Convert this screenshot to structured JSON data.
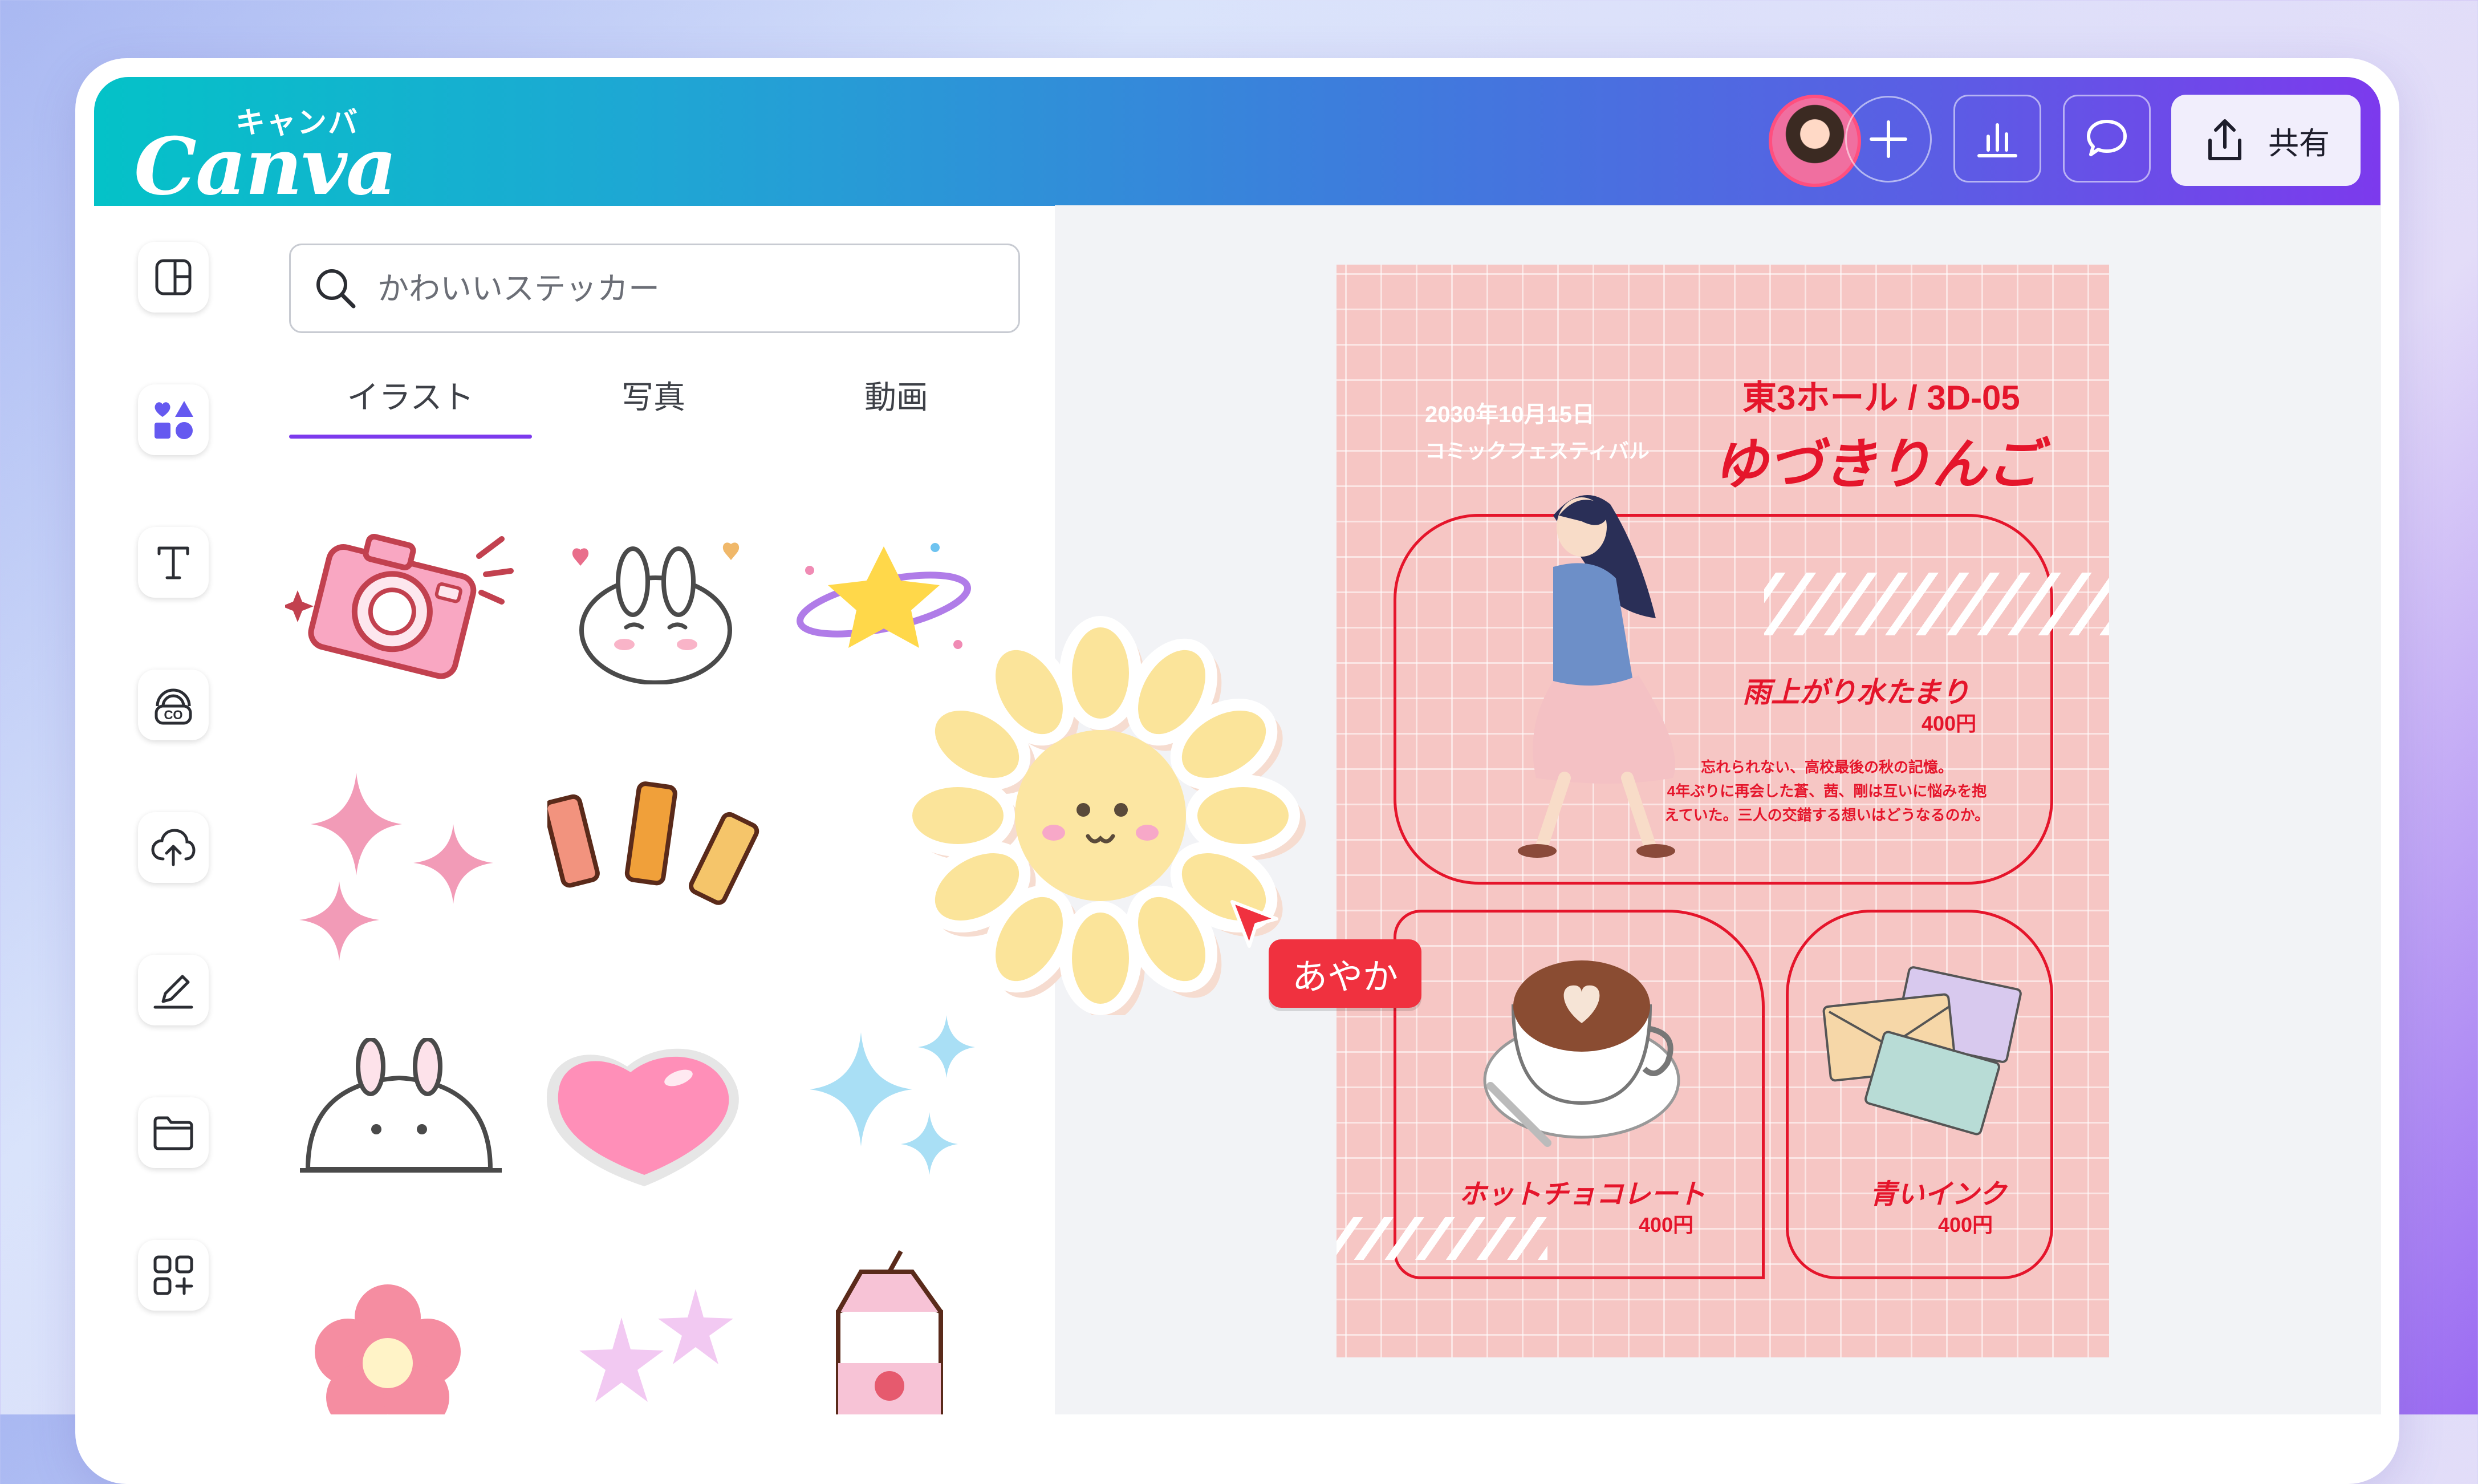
{
  "app": {
    "logo_jp": "キャンバ",
    "logo_en": "Canva"
  },
  "topbar": {
    "share_label": "共有",
    "icons": [
      "avatar",
      "plus-icon",
      "analytics-icon",
      "comment-icon",
      "share-icon"
    ]
  },
  "rail": {
    "icons": [
      "layout-icon",
      "elements-icon",
      "text-icon",
      "brand-icon",
      "upload-icon",
      "draw-icon",
      "folder-icon",
      "apps-icon"
    ]
  },
  "panel": {
    "search_placeholder": "かわいいステッカー",
    "tabs": [
      {
        "label": "イラスト",
        "active": true
      },
      {
        "label": "写真",
        "active": false
      },
      {
        "label": "動画",
        "active": false
      }
    ],
    "stickers": [
      "camera",
      "bunny-hearts",
      "star-planet",
      "pink-sparkles",
      "exclaim-bars",
      "sun-flower",
      "peeking-bunny",
      "pink-heart",
      "blue-sparkles",
      "pink-flower",
      "lilac-stars",
      "milk-carton"
    ]
  },
  "collaborator": {
    "name": "あやか",
    "color": "#f0313f"
  },
  "poster": {
    "date": "2030年10月15日",
    "event": "コミックフェスティバル",
    "booth": "東3ホール / 3D-05",
    "artist": "ゆづきりんご",
    "item1": {
      "title": "雨上がり水たまり",
      "price": "400円",
      "desc": [
        "忘れられない、高校最後の秋の記憶。",
        "4年ぶりに再会した蒼、茜、剛は互いに悩みを抱",
        "えていた。三人の交錯する想いはどうなるのか。"
      ]
    },
    "item2": {
      "title": "ホットチョコレート",
      "price": "400円"
    },
    "item3": {
      "title": "青いインク",
      "price": "400円"
    },
    "colors": {
      "background": "#f6c6c4",
      "accent": "#e5152b"
    }
  }
}
